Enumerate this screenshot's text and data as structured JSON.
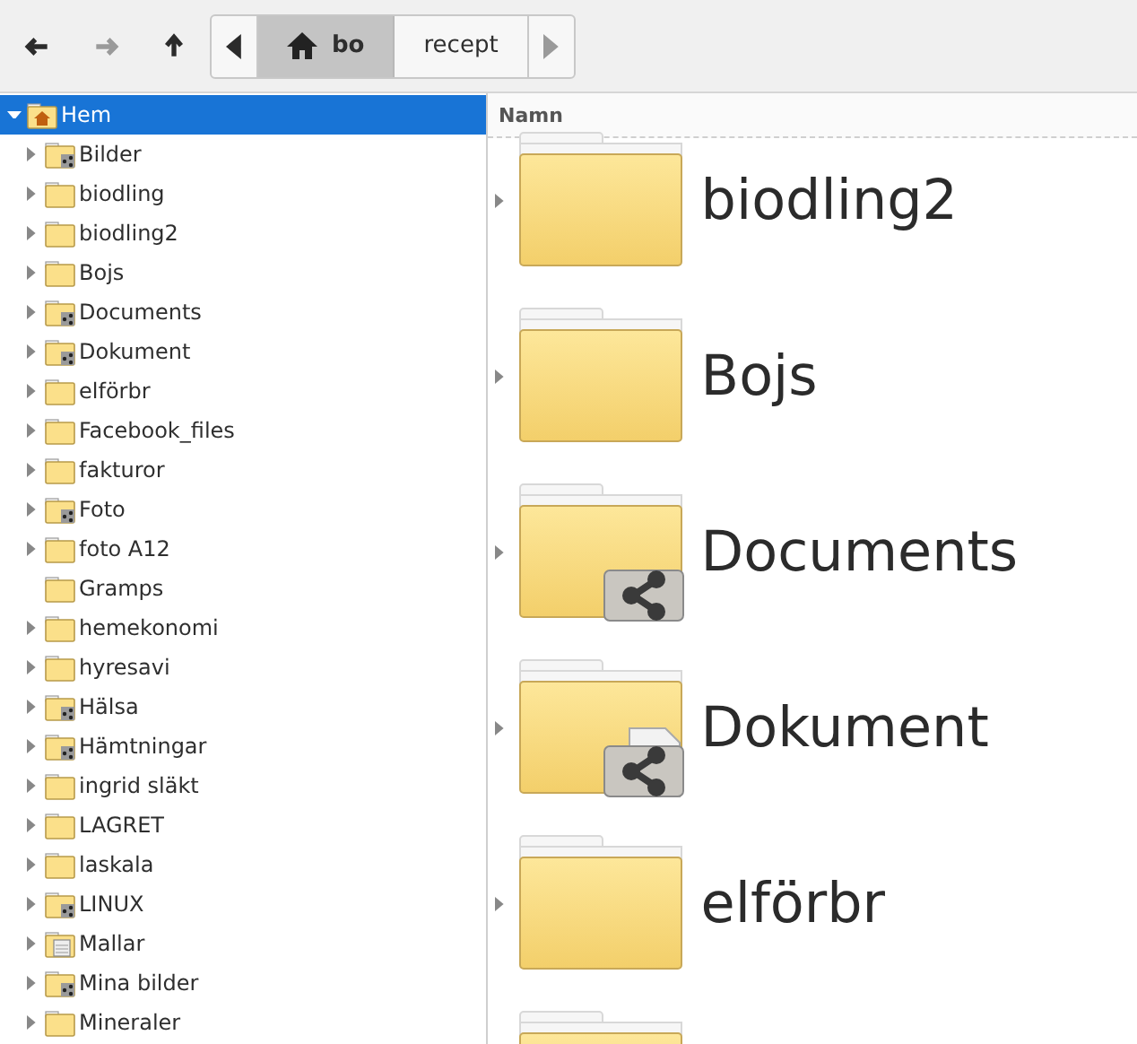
{
  "toolbar": {
    "back": {
      "disabled": false
    },
    "forward": {
      "disabled": true
    },
    "up": {
      "disabled": false
    }
  },
  "breadcrumb": {
    "left_disabled": false,
    "right_disabled": true,
    "segments": [
      {
        "label": "bo",
        "kind": "home",
        "selected": true
      },
      {
        "label": "recept",
        "kind": "folder",
        "selected": false
      }
    ]
  },
  "sidebar": {
    "items": [
      {
        "label": "Hem",
        "kind": "home",
        "expandable": true,
        "expanded": true,
        "selected": true,
        "children": [
          {
            "label": "Bilder",
            "kind": "pictures",
            "expandable": true,
            "expanded": false,
            "selected": false
          },
          {
            "label": "biodling",
            "kind": "folder",
            "expandable": true,
            "expanded": false,
            "selected": false
          },
          {
            "label": "biodling2",
            "kind": "folder",
            "expandable": true,
            "expanded": false,
            "selected": false
          },
          {
            "label": "Bojs",
            "kind": "folder",
            "expandable": true,
            "expanded": false,
            "selected": false
          },
          {
            "label": "Documents",
            "kind": "shared",
            "expandable": true,
            "expanded": false,
            "selected": false
          },
          {
            "label": "Dokument",
            "kind": "shared",
            "expandable": true,
            "expanded": false,
            "selected": false
          },
          {
            "label": "elförbr",
            "kind": "folder",
            "expandable": true,
            "expanded": false,
            "selected": false
          },
          {
            "label": "Facebook_files",
            "kind": "folder",
            "expandable": true,
            "expanded": false,
            "selected": false
          },
          {
            "label": "fakturor",
            "kind": "folder",
            "expandable": true,
            "expanded": false,
            "selected": false
          },
          {
            "label": "Foto",
            "kind": "shared",
            "expandable": true,
            "expanded": false,
            "selected": false
          },
          {
            "label": "foto A12",
            "kind": "folder",
            "expandable": true,
            "expanded": false,
            "selected": false
          },
          {
            "label": "Gramps",
            "kind": "folder",
            "expandable": false,
            "expanded": false,
            "selected": false
          },
          {
            "label": "hemekonomi",
            "kind": "folder",
            "expandable": true,
            "expanded": false,
            "selected": false
          },
          {
            "label": "hyresavi",
            "kind": "folder",
            "expandable": true,
            "expanded": false,
            "selected": false
          },
          {
            "label": "Hälsa",
            "kind": "shared",
            "expandable": true,
            "expanded": false,
            "selected": false
          },
          {
            "label": "Hämtningar",
            "kind": "shared",
            "expandable": true,
            "expanded": false,
            "selected": false
          },
          {
            "label": "ingrid släkt",
            "kind": "folder",
            "expandable": true,
            "expanded": false,
            "selected": false
          },
          {
            "label": "LAGRET",
            "kind": "folder",
            "expandable": true,
            "expanded": false,
            "selected": false
          },
          {
            "label": "laskala",
            "kind": "folder",
            "expandable": true,
            "expanded": false,
            "selected": false
          },
          {
            "label": "LINUX",
            "kind": "shared",
            "expandable": true,
            "expanded": false,
            "selected": false
          },
          {
            "label": "Mallar",
            "kind": "templates",
            "expandable": true,
            "expanded": false,
            "selected": false
          },
          {
            "label": "Mina bilder",
            "kind": "shared",
            "expandable": true,
            "expanded": false,
            "selected": false
          },
          {
            "label": "Mineraler",
            "kind": "folder",
            "expandable": true,
            "expanded": false,
            "selected": false
          }
        ]
      }
    ]
  },
  "list": {
    "columns": [
      "Namn"
    ],
    "rows": [
      {
        "name": "biodling2",
        "kind": "folder"
      },
      {
        "name": "Bojs",
        "kind": "folder"
      },
      {
        "name": "Documents",
        "kind": "shared"
      },
      {
        "name": "Dokument",
        "kind": "shared-document"
      },
      {
        "name": "elförbr",
        "kind": "folder"
      },
      {
        "kind": "folder"
      }
    ]
  }
}
